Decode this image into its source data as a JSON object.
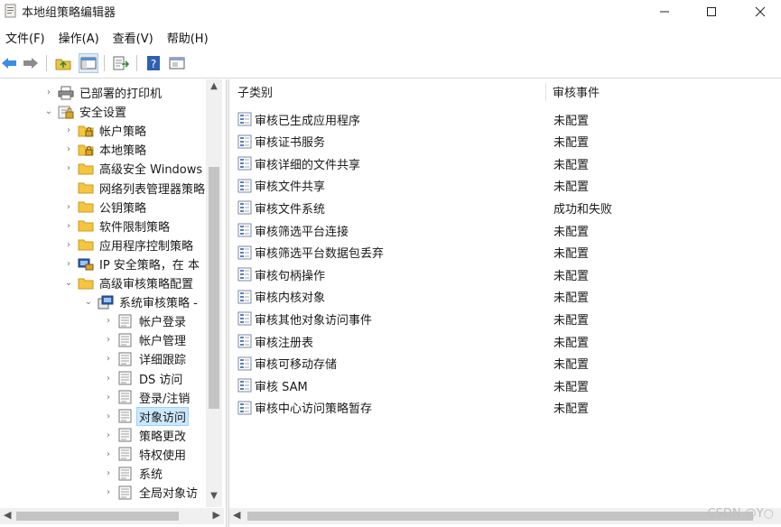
{
  "window": {
    "title": "本地组策略编辑器"
  },
  "menu": [
    "文件(F)",
    "操作(A)",
    "查看(V)",
    "帮助(H)"
  ],
  "toolbar": [
    "back-icon",
    "forward-icon",
    "up-folder-icon",
    "show-hide-tree-icon",
    "export-list-icon",
    "help-icon",
    "properties-icon"
  ],
  "tree": [
    {
      "label": "已部署的打印机",
      "arrow": "›",
      "icon": "printer-icon"
    },
    {
      "label": "安全设置",
      "arrow": "⌄",
      "icon": "security-settings-icon"
    },
    {
      "label": "帐户策略",
      "arrow": "›",
      "icon": "folder-lock-icon"
    },
    {
      "label": "本地策略",
      "arrow": "›",
      "icon": "folder-lock-icon"
    },
    {
      "label": "高级安全 Windows",
      "arrow": "›",
      "icon": "folder-icon"
    },
    {
      "label": "网络列表管理器策略",
      "arrow": "",
      "icon": "folder-icon"
    },
    {
      "label": "公钥策略",
      "arrow": "›",
      "icon": "folder-icon"
    },
    {
      "label": "软件限制策略",
      "arrow": "›",
      "icon": "folder-icon"
    },
    {
      "label": "应用程序控制策略",
      "arrow": "›",
      "icon": "folder-icon"
    },
    {
      "label": "IP 安全策略，在 本",
      "arrow": "›",
      "icon": "ip-security-icon"
    },
    {
      "label": "高级审核策略配置",
      "arrow": "⌄",
      "icon": "folder-icon"
    },
    {
      "label": "系统审核策略 -",
      "arrow": "⌄",
      "icon": "audit-policy-icon"
    },
    {
      "label": "帐户登录",
      "arrow": "›",
      "icon": "policy-list-icon"
    },
    {
      "label": "帐户管理",
      "arrow": "›",
      "icon": "policy-list-icon"
    },
    {
      "label": "详细跟踪",
      "arrow": "›",
      "icon": "policy-list-icon"
    },
    {
      "label": "DS 访问",
      "arrow": "›",
      "icon": "policy-list-icon"
    },
    {
      "label": "登录/注销",
      "arrow": "›",
      "icon": "policy-list-icon"
    },
    {
      "label": "对象访问",
      "arrow": "›",
      "icon": "policy-list-icon",
      "selected": true
    },
    {
      "label": "策略更改",
      "arrow": "›",
      "icon": "policy-list-icon"
    },
    {
      "label": "特权使用",
      "arrow": "›",
      "icon": "policy-list-icon"
    },
    {
      "label": "系统",
      "arrow": "›",
      "icon": "policy-list-icon"
    },
    {
      "label": "全局对象访",
      "arrow": "›",
      "icon": "policy-list-icon"
    }
  ],
  "columns": {
    "subcategory": "子类别",
    "audit_events": "审核事件"
  },
  "rows": [
    {
      "name": "审核已生成应用程序",
      "value": "未配置"
    },
    {
      "name": "审核证书服务",
      "value": "未配置"
    },
    {
      "name": "审核详细的文件共享",
      "value": "未配置"
    },
    {
      "name": "审核文件共享",
      "value": "未配置"
    },
    {
      "name": "审核文件系统",
      "value": "成功和失败"
    },
    {
      "name": "审核筛选平台连接",
      "value": "未配置"
    },
    {
      "name": "审核筛选平台数据包丢弃",
      "value": "未配置"
    },
    {
      "name": "审核句柄操作",
      "value": "未配置"
    },
    {
      "name": "审核内核对象",
      "value": "未配置"
    },
    {
      "name": "审核其他对象访问事件",
      "value": "未配置"
    },
    {
      "name": "审核注册表",
      "value": "未配置"
    },
    {
      "name": "审核可移动存储",
      "value": "未配置"
    },
    {
      "name": "审核 SAM",
      "value": "未配置"
    },
    {
      "name": "审核中心访问策略暂存",
      "value": "未配置"
    }
  ],
  "watermark": "CSDN @Y○",
  "colors": {
    "selection": "#cce8ff",
    "accent": "#0078d7",
    "folder": "#f5c542"
  }
}
